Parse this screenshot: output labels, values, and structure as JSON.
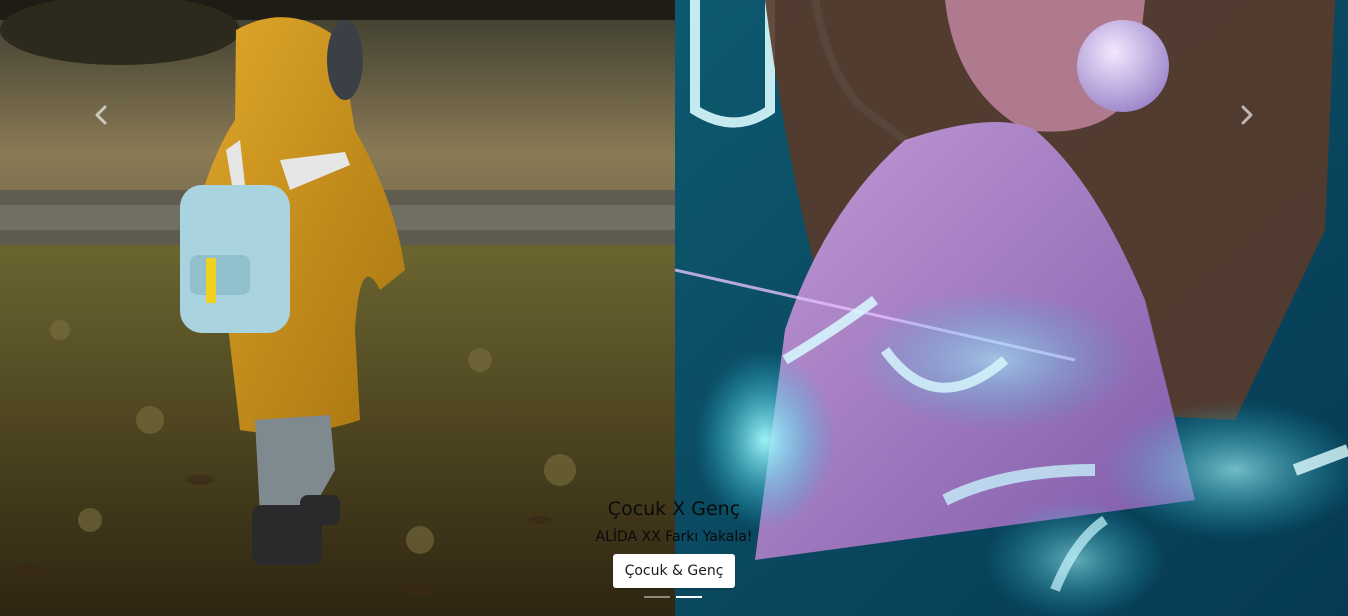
{
  "carousel": {
    "caption": {
      "title": "Çocuk X Genç",
      "subtitle": "ALİDA XX Farkı Yakala!",
      "button_label": "Çocuk & Genç"
    },
    "controls": {
      "prev_icon": "chevron-left-icon",
      "next_icon": "chevron-right-icon"
    },
    "indicators": [
      {
        "active": false
      },
      {
        "active": true
      }
    ],
    "colors": {
      "button_bg": "#ffffff",
      "caption_text": "#0a0a0a",
      "indicator_active": "#ffffff"
    }
  }
}
